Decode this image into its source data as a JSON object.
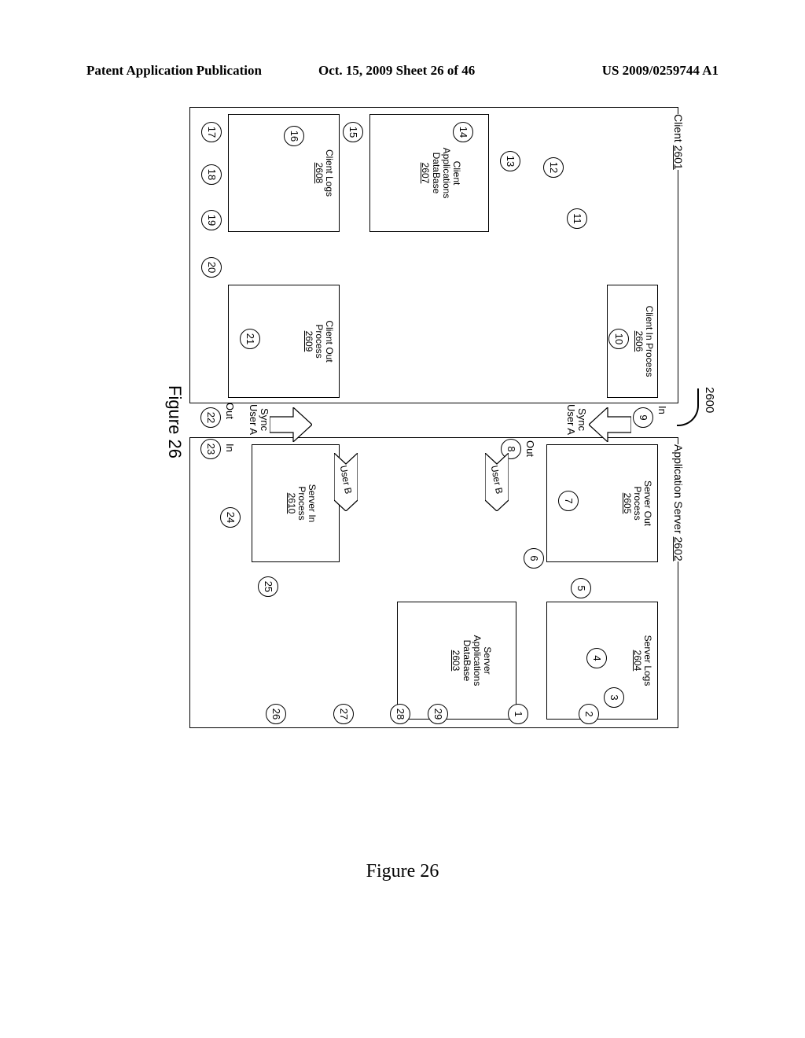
{
  "header": {
    "left": "Patent Application Publication",
    "mid": "Oct. 15, 2009  Sheet 26 of 46",
    "right": "US 2009/0259744 A1"
  },
  "ref": {
    "label": "2600"
  },
  "client": {
    "title": "Client",
    "num": "2601",
    "in_process": {
      "title": "Client In Process",
      "num": "2606"
    },
    "db": {
      "title": "Client\nApplications\nDataBase",
      "num": "2607"
    },
    "logs": {
      "title": "Client Logs",
      "num": "2608"
    },
    "out_process": {
      "title": "Client Out\nProcess",
      "num": "2609"
    }
  },
  "server": {
    "title": "Application Server",
    "num": "2602",
    "logs": {
      "title": "Server Logs",
      "num": "2604"
    },
    "out_process": {
      "title": "Server Out\nProcess",
      "num": "2605"
    },
    "db": {
      "title": "Server\nApplications\nDataBase",
      "num": "2603"
    },
    "in_process": {
      "title": "Server In\nProcess",
      "num": "2610"
    }
  },
  "sync": {
    "down": {
      "main": "Sync",
      "sub": "User A"
    },
    "up": {
      "main": "Sync",
      "sub": "User A"
    },
    "in": "In",
    "out": "Out",
    "flag": "User B"
  },
  "steps": {
    "s1": "1",
    "s2": "2",
    "s3": "3",
    "s4": "4",
    "s5": "5",
    "s6": "6",
    "s7": "7",
    "s8": "8",
    "s9": "9",
    "s10": "10",
    "s11": "11",
    "s12": "12",
    "s13": "13",
    "s14": "14",
    "s15": "15",
    "s16": "16",
    "s17": "17",
    "s18": "18",
    "s19": "19",
    "s20": "20",
    "s21": "21",
    "s22": "22",
    "s23": "23",
    "s24": "24",
    "s25": "25",
    "s26": "26",
    "s27": "27",
    "s28": "28",
    "s29": "29"
  },
  "figure": {
    "rot": "Figure 26",
    "caption": "Figure 26"
  }
}
